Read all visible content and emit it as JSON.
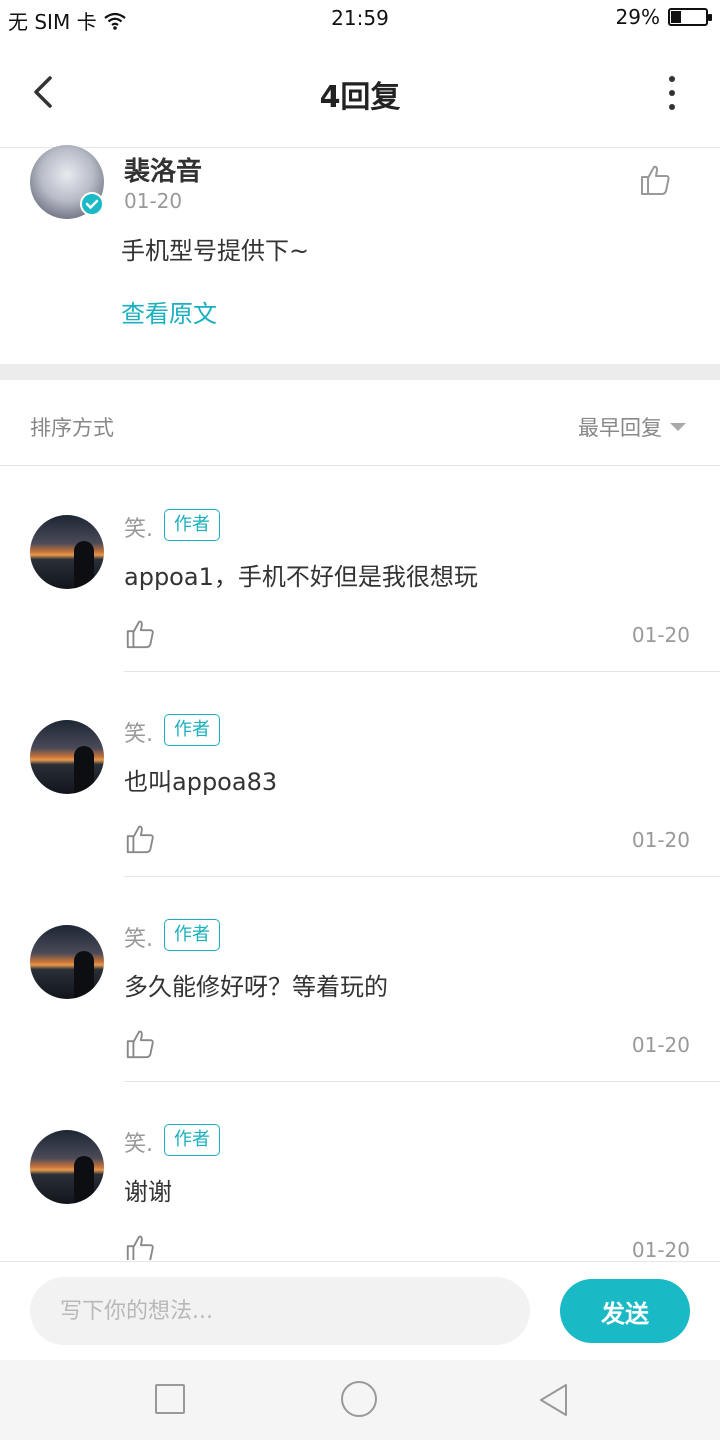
{
  "status_bar": {
    "sim": "无 SIM 卡",
    "time": "21:59",
    "battery": "29%",
    "battery_level": 0.29
  },
  "header": {
    "title": "4回复",
    "back_icon": "chevron-left-icon",
    "more_icon": "more-vertical-icon"
  },
  "original_post": {
    "author": "裴洛音",
    "date": "01-20",
    "text": "手机型号提供下~",
    "view_original": "查看原文"
  },
  "sort": {
    "label": "排序方式",
    "selected": "最早回复"
  },
  "replies": [
    {
      "author": "笑.",
      "badge": "作者",
      "text": "appoa1，手机不好但是我很想玩",
      "date": "01-20"
    },
    {
      "author": "笑.",
      "badge": "作者",
      "text": "也叫appoa83",
      "date": "01-20"
    },
    {
      "author": "笑.",
      "badge": "作者",
      "text": "多久能修好呀？等着玩的",
      "date": "01-20"
    },
    {
      "author": "笑.",
      "badge": "作者",
      "text": "谢谢",
      "date": "01-20"
    }
  ],
  "input_bar": {
    "placeholder": "写下你的想法...",
    "send_label": "发送"
  },
  "colors": {
    "accent": "#19b9c6",
    "link": "#19b0bf"
  }
}
